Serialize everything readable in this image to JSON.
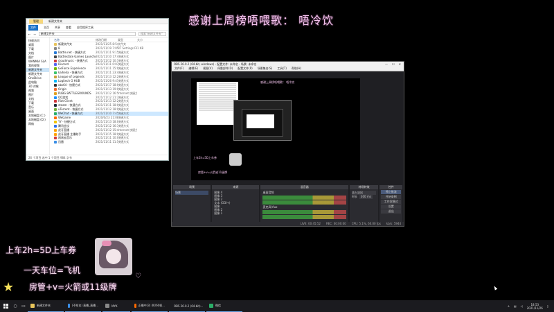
{
  "overlay": {
    "top_text": "感谢上周榜唔喂歌： 唔冷饮",
    "line1": "上车2h=5D上车券",
    "line2": "一天车位=飞机",
    "line3": "房管+v=火箭或11级牌"
  },
  "explorer": {
    "title": "新建文件夹",
    "title_tab": "管理",
    "ribbon": [
      "文件",
      "主页",
      "共享",
      "查看",
      "应用程序工具"
    ],
    "address": "新建文件夹",
    "search_placeholder": "搜索\"新建文件夹\"",
    "nav": [
      "快速访问",
      "桌面",
      "下载",
      "文档",
      "图片",
      "WANMIA SLA",
      "我的视频",
      "新建文件夹",
      "新建文件夹",
      "OneDrive",
      "此电脑",
      "3D 对象",
      "视频",
      "图片",
      "文档",
      "下载",
      "音乐",
      "桌面",
      "本地磁盘 (C:)",
      "本地磁盘 (D:)",
      "网络"
    ],
    "columns": [
      "名称",
      "修改日期",
      "类型",
      "大小"
    ],
    "rows": [
      {
        "name": "新建文件夹",
        "date": "2021/11/25 8:54",
        "type": "文件夹",
        "size": "",
        "color": "#e8c45a"
      },
      {
        "name": "8",
        "date": "2021/11/19 7:05",
        "type": "BT Settings File",
        "size": "1 KB",
        "color": "#888888"
      },
      {
        "name": "Battle.net - 快捷方式",
        "date": "2021/11/11 9:15",
        "type": "快捷方式",
        "size": "",
        "color": "#2a7bd6"
      },
      {
        "name": "Battlestate Games Launcher",
        "date": "2021/11/10 17:42",
        "type": "快捷方式",
        "size": "",
        "color": "#444444"
      },
      {
        "name": "cloudmusic - 快捷方式",
        "date": "2021/11/12 10:15",
        "type": "快捷方式",
        "size": "",
        "color": "#d23a3a"
      },
      {
        "name": "Discord",
        "date": "2021/11/11 0:03",
        "type": "快捷方式",
        "size": "",
        "color": "#5865f2"
      },
      {
        "name": "GeForce Experience",
        "date": "2021/11/11 15:03",
        "type": "快捷方式",
        "size": "",
        "color": "#76b900"
      },
      {
        "name": "kaiheila - 快捷方式",
        "date": "2021/11/11 23:41",
        "type": "快捷方式",
        "size": "",
        "color": "#3ac46b"
      },
      {
        "name": "League of Legends",
        "date": "2021/11/13 12:28",
        "type": "快捷方式",
        "size": "",
        "color": "#c8a23a"
      },
      {
        "name": "Logitech G HUB",
        "date": "2021/11/26 9:41",
        "type": "快捷方式",
        "size": "",
        "color": "#00b8fc"
      },
      {
        "name": "obs64 - 快捷方式",
        "date": "2021/11/17 18:09",
        "type": "快捷方式",
        "size": "",
        "color": "#333333"
      },
      {
        "name": "Origin",
        "date": "2021/11/13 19:08",
        "type": "快捷方式",
        "size": "",
        "color": "#f56c2d"
      },
      {
        "name": "PUBG BATTLEGROUNDS",
        "date": "2021/11/12 16:57",
        "type": "Internet 快捷方式",
        "size": "",
        "color": "#e0a020"
      },
      {
        "name": "QQ游戏",
        "date": "2021/11/12 21:33",
        "type": "快捷方式",
        "size": "",
        "color": "#1e90ff"
      },
      {
        "name": "Riot Client",
        "date": "2021/11/13 12:25",
        "type": "快捷方式",
        "size": "",
        "color": "#d13639"
      },
      {
        "name": "steam - 快捷方式",
        "date": "2021/11/11 18:04",
        "type": "快捷方式",
        "size": "",
        "color": "#1b2838"
      },
      {
        "name": "uTorrent - 快捷方式",
        "date": "2021/11/12 18:01",
        "type": "快捷方式",
        "size": "",
        "color": "#77b33a"
      },
      {
        "name": "WeChat - 快捷方式",
        "date": "2021/11/10 7:45",
        "type": "快捷方式",
        "size": "",
        "color": "#2aae67"
      },
      {
        "name": "WeGame",
        "date": "2020/6/23 21:08",
        "type": "快捷方式",
        "size": "",
        "color": "#ff6a00"
      },
      {
        "name": "YY - 快捷方式",
        "date": "2021/11/13 18:04",
        "type": "快捷方式",
        "size": "",
        "color": "#f2c200"
      },
      {
        "name": "腾讯会议",
        "date": "2021/11/12 16:38",
        "type": "快捷方式",
        "size": "",
        "color": "#2c6df2"
      },
      {
        "name": "虎牙直播",
        "date": "2021/11/12 15:47",
        "type": "Internet 快捷方式",
        "size": "",
        "color": "#ffa200"
      },
      {
        "name": "虎牙直播 主播助手",
        "date": "2021/11/15 18:04",
        "type": "快捷方式",
        "size": "",
        "color": "#ffa200"
      },
      {
        "name": "网易云音乐",
        "date": "2021/11/11 10:08",
        "type": "快捷方式",
        "size": "",
        "color": "#d23a3a"
      },
      {
        "name": "迅雷",
        "date": "2021/11/11 11:55",
        "type": "快捷方式",
        "size": "",
        "color": "#3a8ee6"
      }
    ],
    "status": "26 个项目    选中 1 个项目  984 字节"
  },
  "obs": {
    "title": "OBS 26.0.2 (64-bit, windows) - 配置文件: 未命名 - 场景: 未命名",
    "menu": [
      "文件(F)",
      "编辑(E)",
      "视图(V)",
      "停靠部件(D)",
      "配置文件(P)",
      "场景集合(S)",
      "工具(T)",
      "帮助(H)"
    ],
    "preview_text1": "感谢上周榜唔喂歌： 唔冷饮",
    "preview_text2": "上车2h=5D上车券",
    "preview_text3": "房管+v=火箭或11级牌",
    "docks": {
      "scenes_h": "场景",
      "scenes": [
        "场景"
      ],
      "sources_h": "来源",
      "sources": [
        "图像 4",
        "图像 3",
        "图像 2",
        "文本 (GDI+)",
        "图像",
        "图像 2",
        "图像 1"
      ],
      "mixer_h": "混音器",
      "mixer": [
        "桌面音频",
        "麦克风/Aux"
      ],
      "trans_h": "转场特效",
      "trans": [
        "淡入淡出",
        "时长",
        "300 ms"
      ],
      "ctrl_h": "控件",
      "ctrl": [
        "停止推流",
        "开始录制",
        "工作室模式",
        "设置",
        "退出"
      ]
    },
    "status": [
      "LIVE: 00:45:52",
      "REC: 00:00:00",
      "CPU: 5.1%, 60.00 fps",
      "kb/s: 5944"
    ]
  },
  "taskbar": {
    "items": [
      "新建文件夹",
      "(不知名) 直播_直播...",
      "MYK",
      "正播中(3) 4K/60帧...",
      "OBS 26.0.2 (64-bit)...",
      "微信"
    ],
    "time": "18:53",
    "date": "2021/11/26"
  }
}
